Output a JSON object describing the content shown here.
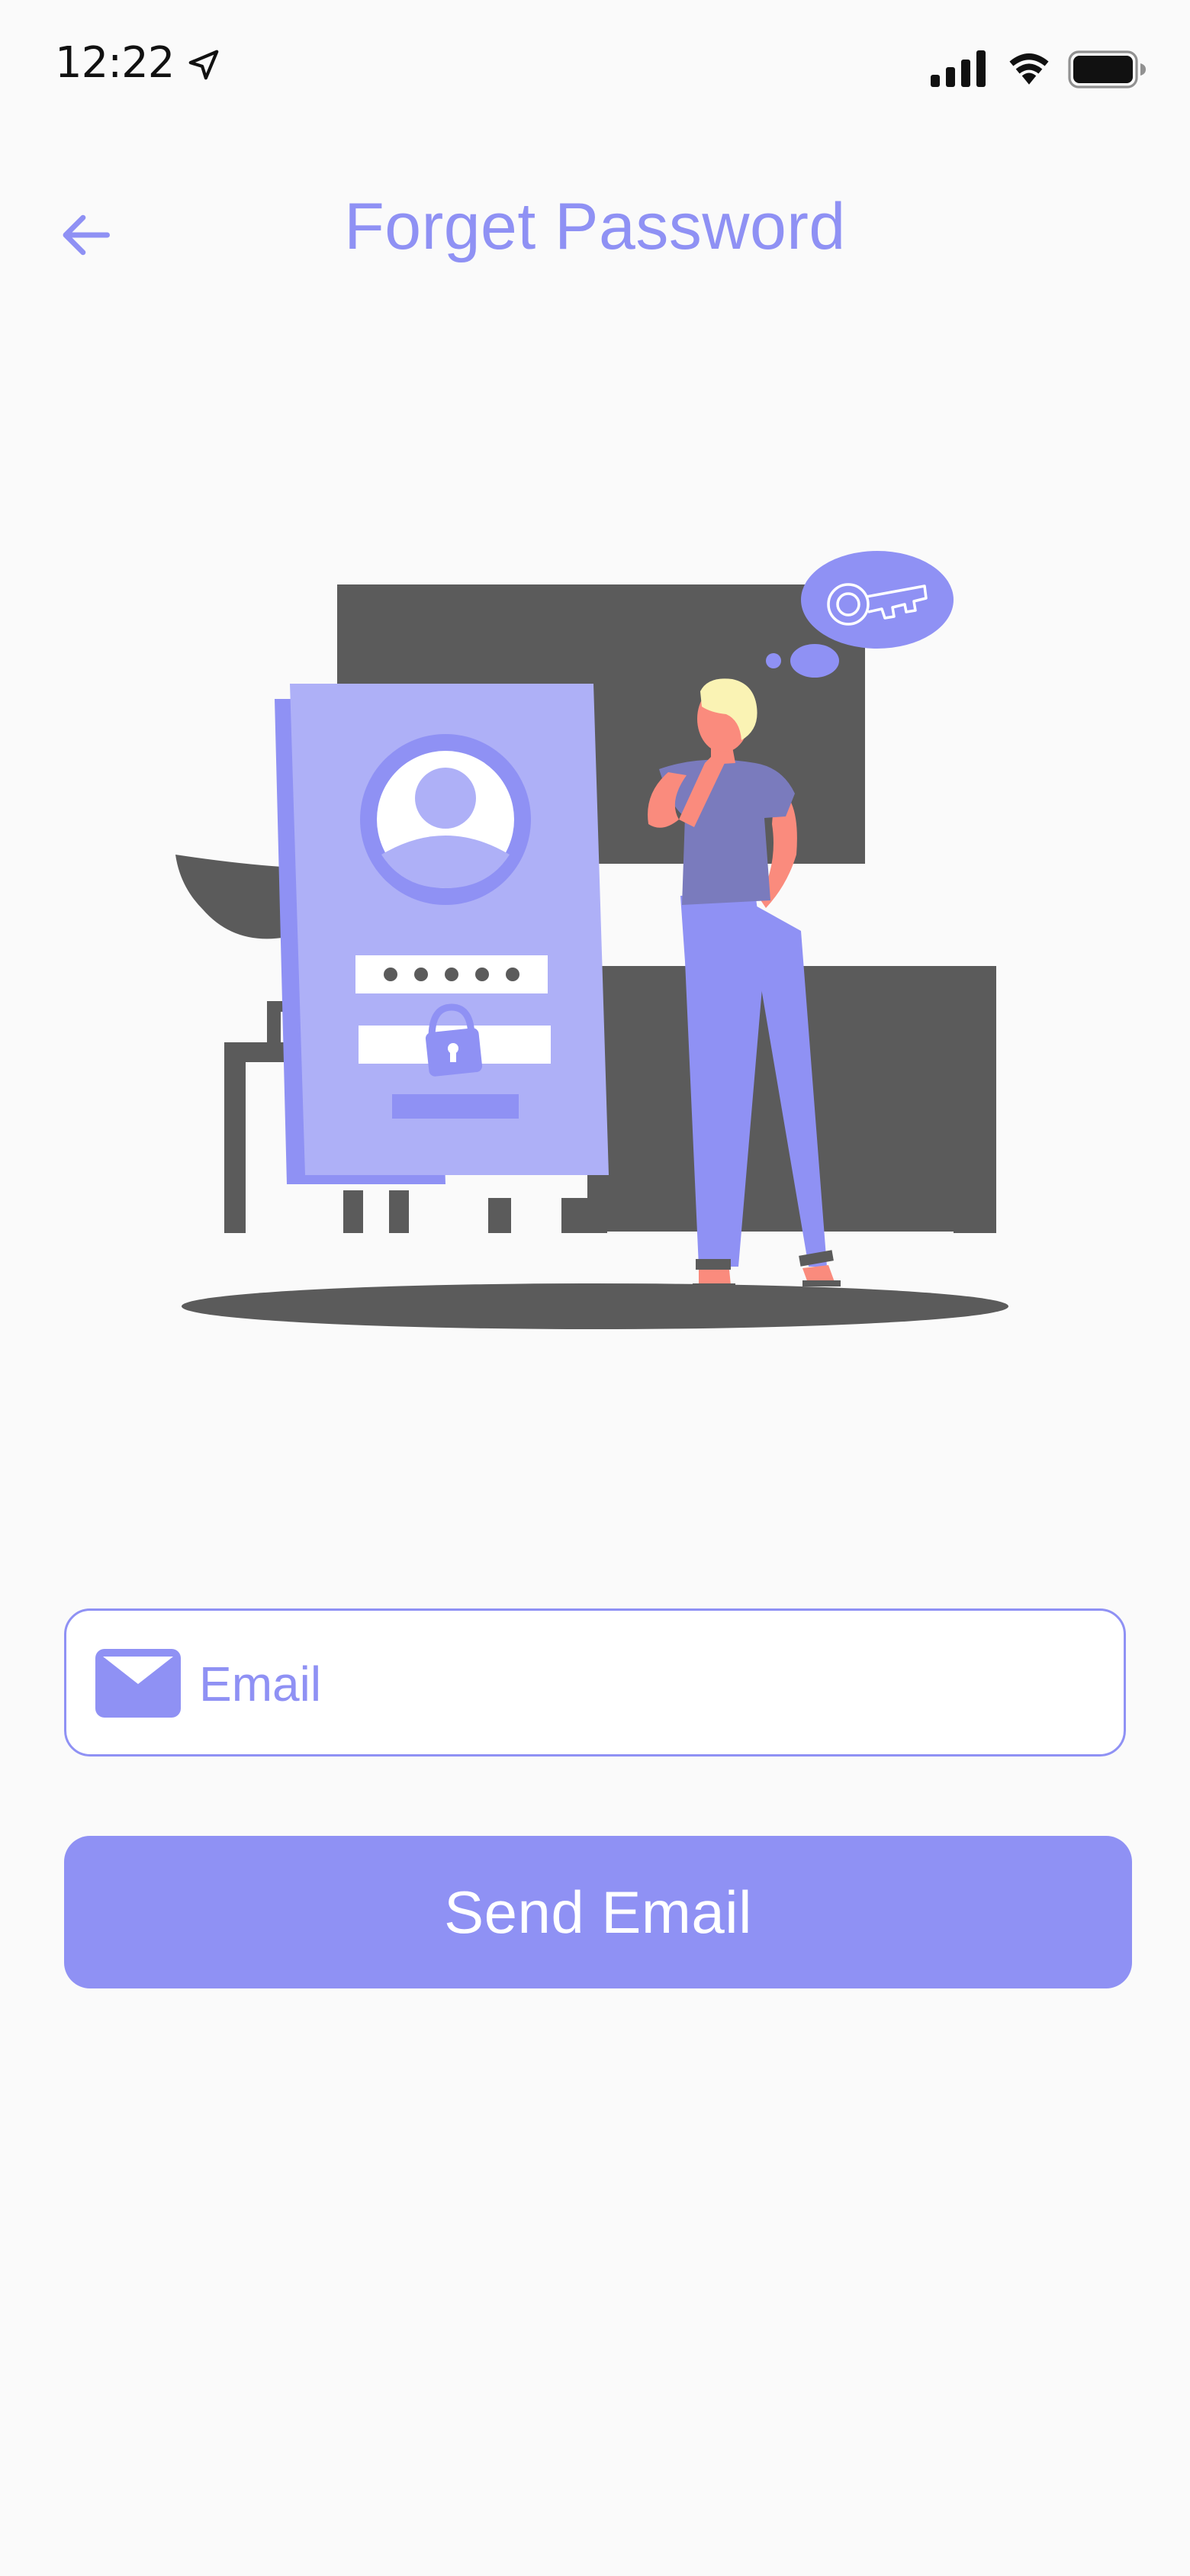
{
  "status_bar": {
    "time": "12:22",
    "icons": [
      "location-arrow-icon",
      "cellular-signal-icon",
      "wifi-icon",
      "battery-icon"
    ]
  },
  "header": {
    "title": "Forget Password",
    "back_icon": "arrow-left-icon"
  },
  "illustration": {
    "subject": "person-thinking-about-password",
    "icons": [
      "user-avatar-icon",
      "padlock-icon",
      "key-icon",
      "thought-bubble-icon"
    ]
  },
  "form": {
    "email": {
      "icon": "envelope-icon",
      "placeholder": "Email",
      "value": ""
    },
    "submit_label": "Send Email"
  },
  "colors": {
    "accent": "#8f91f4",
    "accent_light": "#aeb0f7",
    "dark_gray": "#5b5b5b",
    "background": "#fafafa",
    "skin": "#fa8b7d",
    "hair": "#faf3b4",
    "shirt": "#7a7bbd"
  }
}
